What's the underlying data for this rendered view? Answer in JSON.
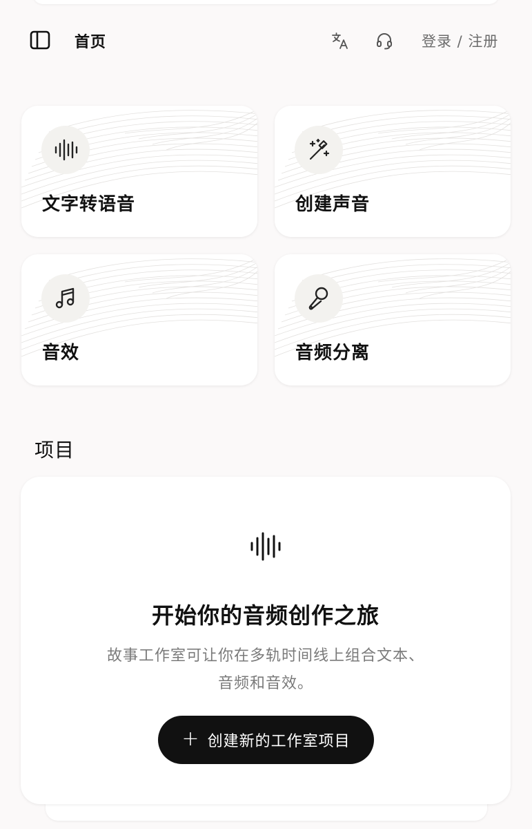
{
  "header": {
    "title": "首页",
    "sidebar_toggle_icon": "sidebar-panel-icon",
    "translate_icon": "translate-icon",
    "support_icon": "headset-icon",
    "auth_label": "登录 / 注册"
  },
  "features": [
    {
      "label": "文字转语音",
      "icon": "sound-wave-icon"
    },
    {
      "label": "创建声音",
      "icon": "magic-wand-icon"
    },
    {
      "label": "音效",
      "icon": "music-note-icon"
    },
    {
      "label": "音频分离",
      "icon": "microphone-icon"
    }
  ],
  "projects": {
    "section_title": "项目",
    "empty_icon": "sound-wave-icon",
    "empty_title": "开始你的音频创作之旅",
    "empty_description_line1": "故事工作室可让你在多轨时间线上组合文本、",
    "empty_description_line2": "音频和音效。",
    "create_button_icon": "plus-icon",
    "create_button_label": "创建新的工作室项目"
  },
  "colors": {
    "background": "#fbf9f9",
    "card": "#ffffff",
    "icon_circle": "#f3f2ef",
    "primary_button": "#111111",
    "muted_text": "#7a7a7a"
  }
}
